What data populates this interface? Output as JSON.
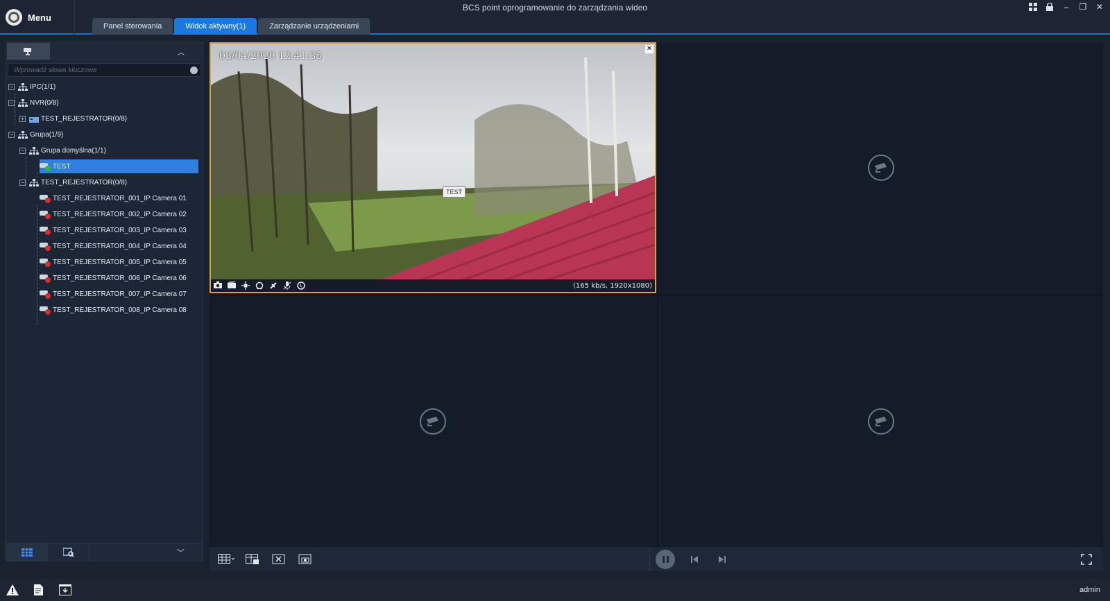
{
  "app": {
    "title": "BCS point oprogramowanie do zarządzania wideo",
    "menu_label": "Menu",
    "accent": "#1b78e0"
  },
  "tabs": [
    {
      "label": "Panel sterowania"
    },
    {
      "label": "Widok aktywny(1)"
    },
    {
      "label": "Zarządzanie urządzeniami"
    }
  ],
  "sidebar": {
    "search_placeholder": "Wprowadź słowa kluczowe",
    "tree": {
      "ipc": "IPC(1/1)",
      "nvr": "NVR(0/8)",
      "nvr_child": "TEST_REJESTRATOR(0/8)",
      "group": "Grupa(1/9)",
      "default_group": "Grupa domyślna(1/1)",
      "test": "TEST",
      "recorder_group": "TEST_REJESTRATOR(0/8)",
      "cameras": [
        "TEST_REJESTRATOR_001_IP Camera 01",
        "TEST_REJESTRATOR_002_IP Camera 02",
        "TEST_REJESTRATOR_003_IP Camera 03",
        "TEST_REJESTRATOR_004_IP Camera 04",
        "TEST_REJESTRATOR_005_IP Camera 05",
        "TEST_REJESTRATOR_006_IP Camera 06",
        "TEST_REJESTRATOR_007_IP Camera 07",
        "TEST_REJESTRATOR_008_IP Camera 08"
      ]
    }
  },
  "video": {
    "timestamp": "03/04/2020  12:41:35",
    "channel_name": "TEST",
    "stream_info": "(165 kb/s, 1920x1080)"
  },
  "status": {
    "user": "admin"
  }
}
